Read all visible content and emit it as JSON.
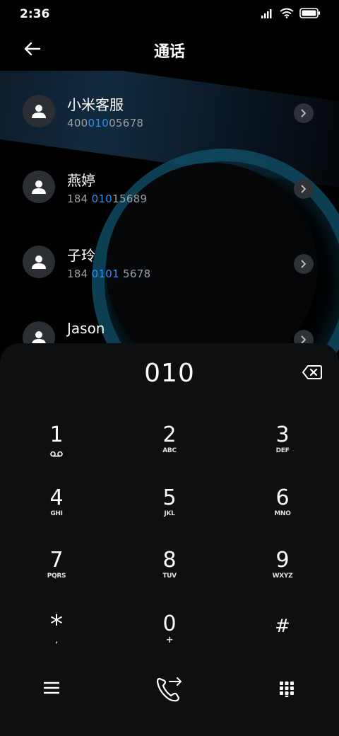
{
  "status": {
    "time": "2:36"
  },
  "header": {
    "title": "通话"
  },
  "contacts": [
    {
      "name": "小米客服",
      "num_pre": "400",
      "num_hl": "010",
      "num_post": "05678"
    },
    {
      "name": "燕婷",
      "num_pre": "184 ",
      "num_hl": "010",
      "num_post": "15689"
    },
    {
      "name": "子玲",
      "num_pre": "184 ",
      "num_hl": "0101",
      "num_post": " 5678"
    },
    {
      "name": "Jason",
      "num_pre": "",
      "num_hl": "",
      "num_post": ""
    }
  ],
  "dialer": {
    "input": "010",
    "keys": [
      {
        "num": "1",
        "sub": "voicemail"
      },
      {
        "num": "2",
        "sub": "ABC"
      },
      {
        "num": "3",
        "sub": "DEF"
      },
      {
        "num": "4",
        "sub": "GHI"
      },
      {
        "num": "5",
        "sub": "JKL"
      },
      {
        "num": "6",
        "sub": "MNO"
      },
      {
        "num": "7",
        "sub": "PQRS"
      },
      {
        "num": "8",
        "sub": "TUV"
      },
      {
        "num": "9",
        "sub": "WXYZ"
      },
      {
        "num": "*",
        "sub": ","
      },
      {
        "num": "0",
        "sub": "+"
      },
      {
        "num": "#",
        "sub": ""
      }
    ]
  },
  "icons": {
    "back": "back-arrow-icon",
    "chevron": "chevron-right-icon",
    "backspace": "backspace-icon",
    "menu": "menu-icon",
    "call": "call-icon",
    "keypad": "keypad-icon"
  },
  "colors": {
    "accent": "#2f8ef5",
    "panel": "#0e0f11",
    "avatar": "#2b2e33"
  }
}
